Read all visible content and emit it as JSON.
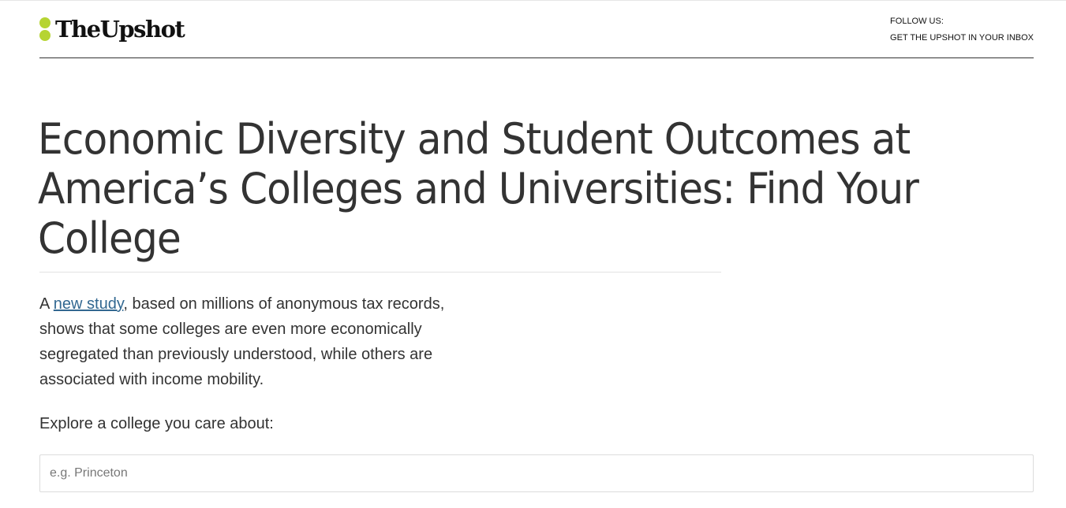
{
  "header": {
    "logo_text": "TheUpshot",
    "follow_label": "FOLLOW US:",
    "newsletter_link": "GET THE UPSHOT IN YOUR INBOX",
    "brand_dot_color": "#b6d433"
  },
  "article": {
    "headline_lines": [
      "Economic Diversity and Student Outcomes at",
      "America’s Colleges and Universities: Find Your",
      "College"
    ],
    "intro_prefix": "A ",
    "intro_link": "new study",
    "intro_lines": [
      ", based on millions of anonymous tax records,",
      "shows that some colleges are even more economically",
      "segregated than previously understood, while others are",
      "associated with income mobility."
    ],
    "link_color": "#326891",
    "explore_label": "Explore a college you care about:"
  },
  "search": {
    "placeholder": "e.g. Princeton",
    "value": ""
  }
}
